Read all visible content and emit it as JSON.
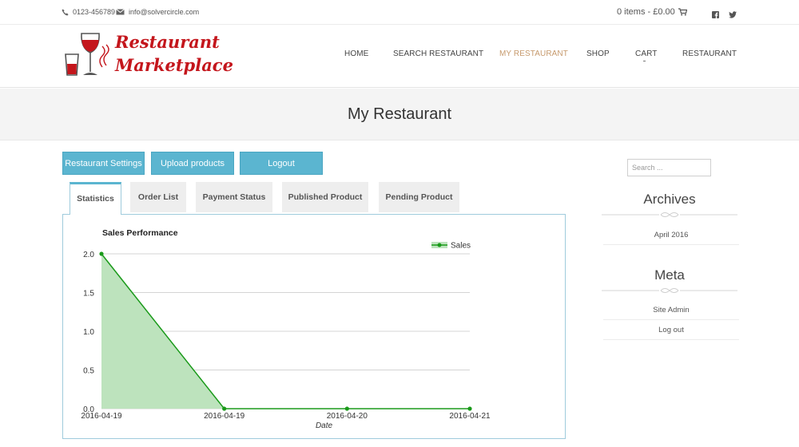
{
  "topbar": {
    "phone": "0123-456789",
    "email": "info@solvercircle.com",
    "cart_summary": "0 items - £0.00",
    "social_icons": [
      "facebook-icon",
      "twitter-icon"
    ]
  },
  "brand": {
    "line1": "Restaurant",
    "line2": "Marketplace",
    "color": "#c4161c"
  },
  "nav": {
    "items": [
      {
        "label": "HOME"
      },
      {
        "label": "SEARCH RESTAURANT"
      },
      {
        "label": "MY RESTAURANT",
        "active": true
      },
      {
        "label": "SHOP"
      },
      {
        "label": "CART"
      },
      {
        "label": "RESTAURANT"
      }
    ],
    "active_color": "#c69a6d"
  },
  "page": {
    "title": "My Restaurant"
  },
  "actions": {
    "settings": "Restaurant Settings",
    "upload": "Upload products",
    "logout": "Logout",
    "color": "#5bb5d0"
  },
  "tabs": [
    {
      "label": "Statistics",
      "active": true
    },
    {
      "label": "Order List"
    },
    {
      "label": "Payment Status"
    },
    {
      "label": "Published Product"
    },
    {
      "label": "Pending Product"
    }
  ],
  "sidebar": {
    "search_placeholder": "Search ...",
    "archives_title": "Archives",
    "archives": [
      "April 2016"
    ],
    "meta_title": "Meta",
    "meta_links": [
      "Site Admin",
      "Log out"
    ]
  },
  "chart_data": {
    "type": "area",
    "title": "Sales Performance",
    "xlabel": "Date",
    "ylabel": "",
    "x": [
      "2016-04-19",
      "2016-04-19",
      "2016-04-20",
      "2016-04-21"
    ],
    "series": [
      {
        "name": "Sales",
        "values": [
          2,
          0,
          0,
          0
        ],
        "color": "#1a9a1a",
        "fill": "#bde3bd"
      }
    ],
    "ylim": [
      0,
      2
    ],
    "yticks": [
      "0.0",
      "0.5",
      "1.0",
      "1.5",
      "2.0"
    ],
    "grid": true,
    "legend": "top-right"
  }
}
